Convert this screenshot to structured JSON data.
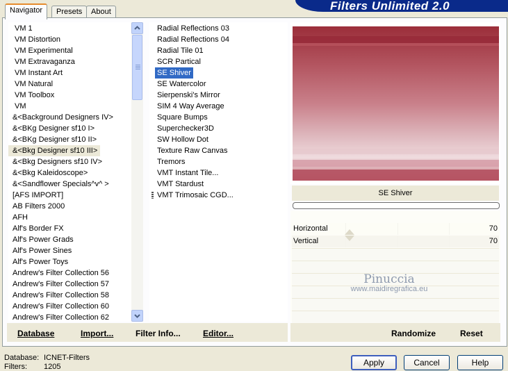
{
  "tabs": [
    {
      "label": "Navigator"
    },
    {
      "label": "Presets"
    },
    {
      "label": "About"
    }
  ],
  "banner": {
    "title": "Filters Unlimited 2.0"
  },
  "categories": [
    "VM 1",
    "VM Distortion",
    "VM Experimental",
    "VM Extravaganza",
    "VM Instant Art",
    "VM Natural",
    "VM Toolbox",
    "VM",
    "&<Background Designers IV>",
    "&<BKg Designer sf10 I>",
    "&<BKg Designer sf10 II>",
    "&<Bkg Designer sf10 III>",
    "&<Bkg Designers sf10 IV>",
    "&<Bkg Kaleidoscope>",
    "&<Sandflower Specials^v^ >",
    "[AFS IMPORT]",
    "AB Filters 2000",
    "AFH",
    "Alf's Border FX",
    "Alf's Power Grads",
    "Alf's Power Sines",
    "Alf's Power Toys",
    "Andrew's Filter Collection 56",
    "Andrew's Filter Collection 57",
    "Andrew's Filter Collection 58",
    "Andrew's Filter Collection 60",
    "Andrew's Filter Collection 62"
  ],
  "filters": [
    "Radial Reflections 03",
    "Radial Reflections 04",
    "Radial Tile 01",
    "SCR  Partical",
    "SE Shiver",
    "SE Watercolor",
    "Sierpenski's Mirror",
    "SIM 4 Way Average",
    "Square Bumps",
    "Superchecker3D",
    "SW Hollow Dot",
    "Texture Raw Canvas",
    "Tremors",
    "VMT Instant Tile...",
    "VMT Stardust",
    "VMT Trimosaic CGD..."
  ],
  "selected_category_index": 11,
  "selected_filter_index": 4,
  "left_buttons": {
    "database": "Database",
    "import": "Import...",
    "filter_info": "Filter Info...",
    "editor": "Editor..."
  },
  "filter_title": "SE Shiver",
  "sliders": [
    {
      "label": "Horizontal",
      "value": "70",
      "fraction": 0.28
    },
    {
      "label": "Vertical",
      "value": "70",
      "fraction": 0.28
    }
  ],
  "watermark": {
    "line1": "Pinuccia",
    "line2": "www.maidiregrafica.eu"
  },
  "right_buttons": {
    "randomize": "Randomize",
    "reset": "Reset"
  },
  "status": {
    "database_label": "Database:",
    "database_value": "ICNET-Filters",
    "filters_label": "Filters:",
    "filters_value": "1205"
  },
  "dialog_buttons": {
    "apply": "Apply",
    "cancel": "Cancel",
    "help": "Help"
  },
  "colors": {
    "selection_blue": "#316ac5",
    "banner_blue": "#0a2a8a",
    "tab_accent": "#e68b2c"
  }
}
